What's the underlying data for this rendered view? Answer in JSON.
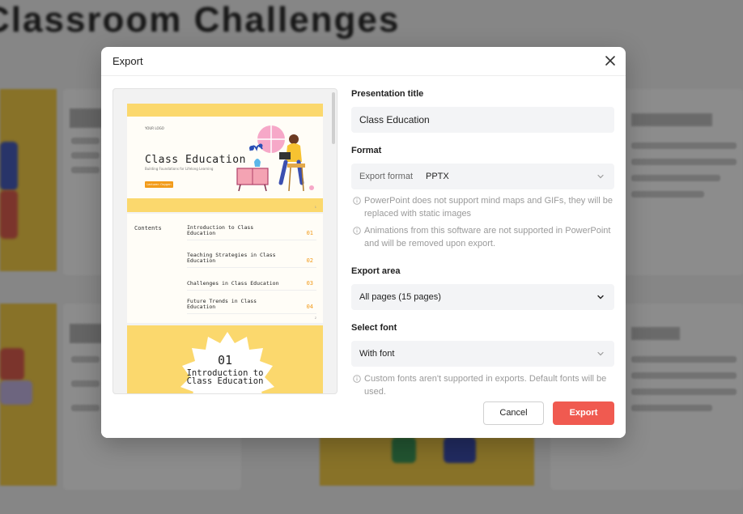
{
  "background": {
    "page_heading": "Classroom Challenges"
  },
  "dialog": {
    "title": "Export",
    "close_icon": "close-icon"
  },
  "preview": {
    "slide1": {
      "logo": "YOUR LOGO",
      "title": "Class Education",
      "subtitle": "Building Foundations for Lifelong Learning",
      "button": "Lecturer: Oxygen",
      "page": "1"
    },
    "slide2": {
      "title": "Contents",
      "items": [
        {
          "text": "Introduction to Class Education",
          "num": "01"
        },
        {
          "text": "Teaching Strategies in Class Education",
          "num": "02"
        },
        {
          "text": "Challenges in Class Education",
          "num": "03"
        },
        {
          "text": "Future Trends in Class Education",
          "num": "04"
        }
      ],
      "page": "2"
    },
    "slide3": {
      "number": "01",
      "title_line1": "Introduction to",
      "title_line2": "Class Education"
    }
  },
  "form": {
    "title_label": "Presentation title",
    "title_value": "Class Education",
    "format_label": "Format",
    "format_prefix": "Export format",
    "format_value": "PPTX",
    "note_mindmaps": "PowerPoint does not support mind maps and GIFs, they will be replaced with static images",
    "note_animations": "Animations from this software are not supported in PowerPoint and will be removed upon export.",
    "area_label": "Export area",
    "area_value": "All pages (15 pages)",
    "font_label": "Select font",
    "font_value": "With font",
    "note_fonts": "Custom fonts aren't supported in exports. Default fonts will be used."
  },
  "footer": {
    "cancel_label": "Cancel",
    "export_label": "Export"
  },
  "colors": {
    "accent": "#f05a50",
    "slide_yellow": "#fbd86d",
    "slide_orange": "#f29b1a"
  }
}
